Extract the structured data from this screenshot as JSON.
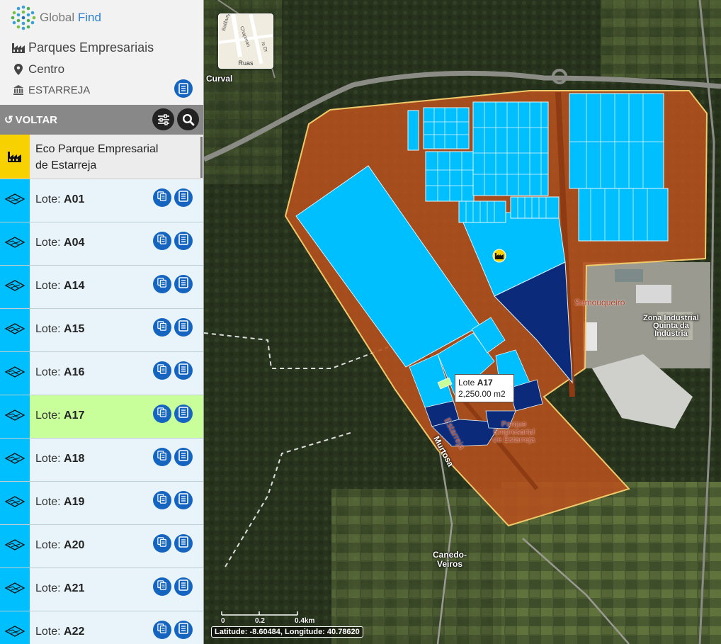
{
  "app": {
    "brand_primary": "Global",
    "brand_secondary": "Find"
  },
  "header": {
    "category": "Parques Empresariais",
    "region": "Centro",
    "municipality": "ESTARREJA"
  },
  "toolbar": {
    "back_label": "VOLTAR",
    "back_icon": "refresh-back-icon",
    "filter_icon": "sliders-icon",
    "search_icon": "search-icon"
  },
  "park": {
    "name": "Eco Parque Empresarial de Estarreja",
    "icon": "factory-icon"
  },
  "lots": {
    "prefix": "Lote: ",
    "items": [
      {
        "code": "A01"
      },
      {
        "code": "A04"
      },
      {
        "code": "A14"
      },
      {
        "code": "A15"
      },
      {
        "code": "A16"
      },
      {
        "code": "A17",
        "selected": true
      },
      {
        "code": "A18"
      },
      {
        "code": "A19"
      },
      {
        "code": "A20"
      },
      {
        "code": "A21"
      },
      {
        "code": "A22"
      }
    ]
  },
  "map": {
    "labels": {
      "curval": "Curval",
      "samouqueiro": "Samouqueiro",
      "zona1": "Zona Industrial",
      "zona2": "Quinta da",
      "zona3": "Indústria",
      "road1": "Estarreja",
      "road2": "Murtosa",
      "park1": "Parque",
      "park2": "Empresarial",
      "park3": "de Estarreja",
      "canedo1": "Canedo-",
      "canedo2": "Veiros"
    },
    "basemap_thumb": {
      "label": "Ruas",
      "streets": [
        "Bailbury",
        "Chapman",
        "Is Dr"
      ]
    },
    "tooltip": {
      "prefix": "Lote ",
      "code": "A17",
      "area": "2,250.00 m2"
    },
    "scale": {
      "t0": "0",
      "t1": "0.2",
      "t2": "0.4km"
    },
    "coords": "Latitude: -8.60484, Longitude: 40.78620"
  },
  "colors": {
    "park_fill": "#b7511e",
    "lot_available": "#00bfff",
    "lot_occupied": "#0b2a7a",
    "selected_lot": "#c9ff9a",
    "accent_blue": "#1565c0",
    "park_marker": "#f7d200"
  }
}
